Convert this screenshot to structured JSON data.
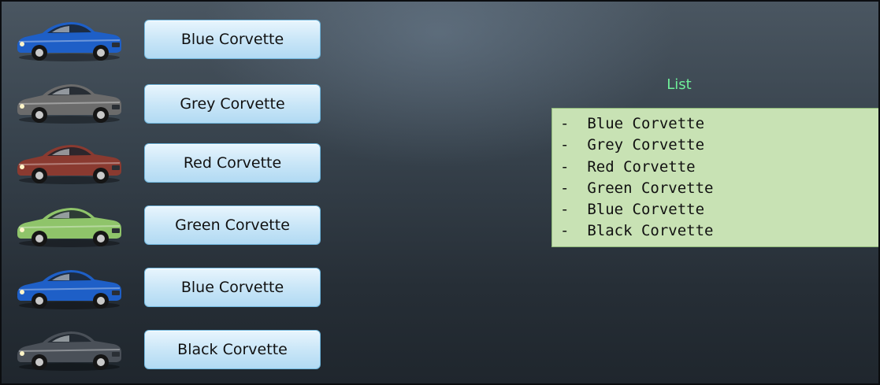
{
  "buttons": [
    {
      "label": "Blue Corvette",
      "color": "#1e5fc7"
    },
    {
      "label": "Grey Corvette",
      "color": "#6b6b6b"
    },
    {
      "label": "Red Corvette",
      "color": "#8a3a30"
    },
    {
      "label": "Green Corvette",
      "color": "#8fc46a"
    },
    {
      "label": "Blue Corvette",
      "color": "#1e5fc7"
    },
    {
      "label": "Black Corvette",
      "color": "#4a5058"
    }
  ],
  "list": {
    "title": "List",
    "bullet": "-",
    "items": [
      "Blue Corvette",
      "Grey Corvette",
      "Red Corvette",
      "Green Corvette",
      "Blue Corvette",
      "Black Corvette"
    ]
  }
}
